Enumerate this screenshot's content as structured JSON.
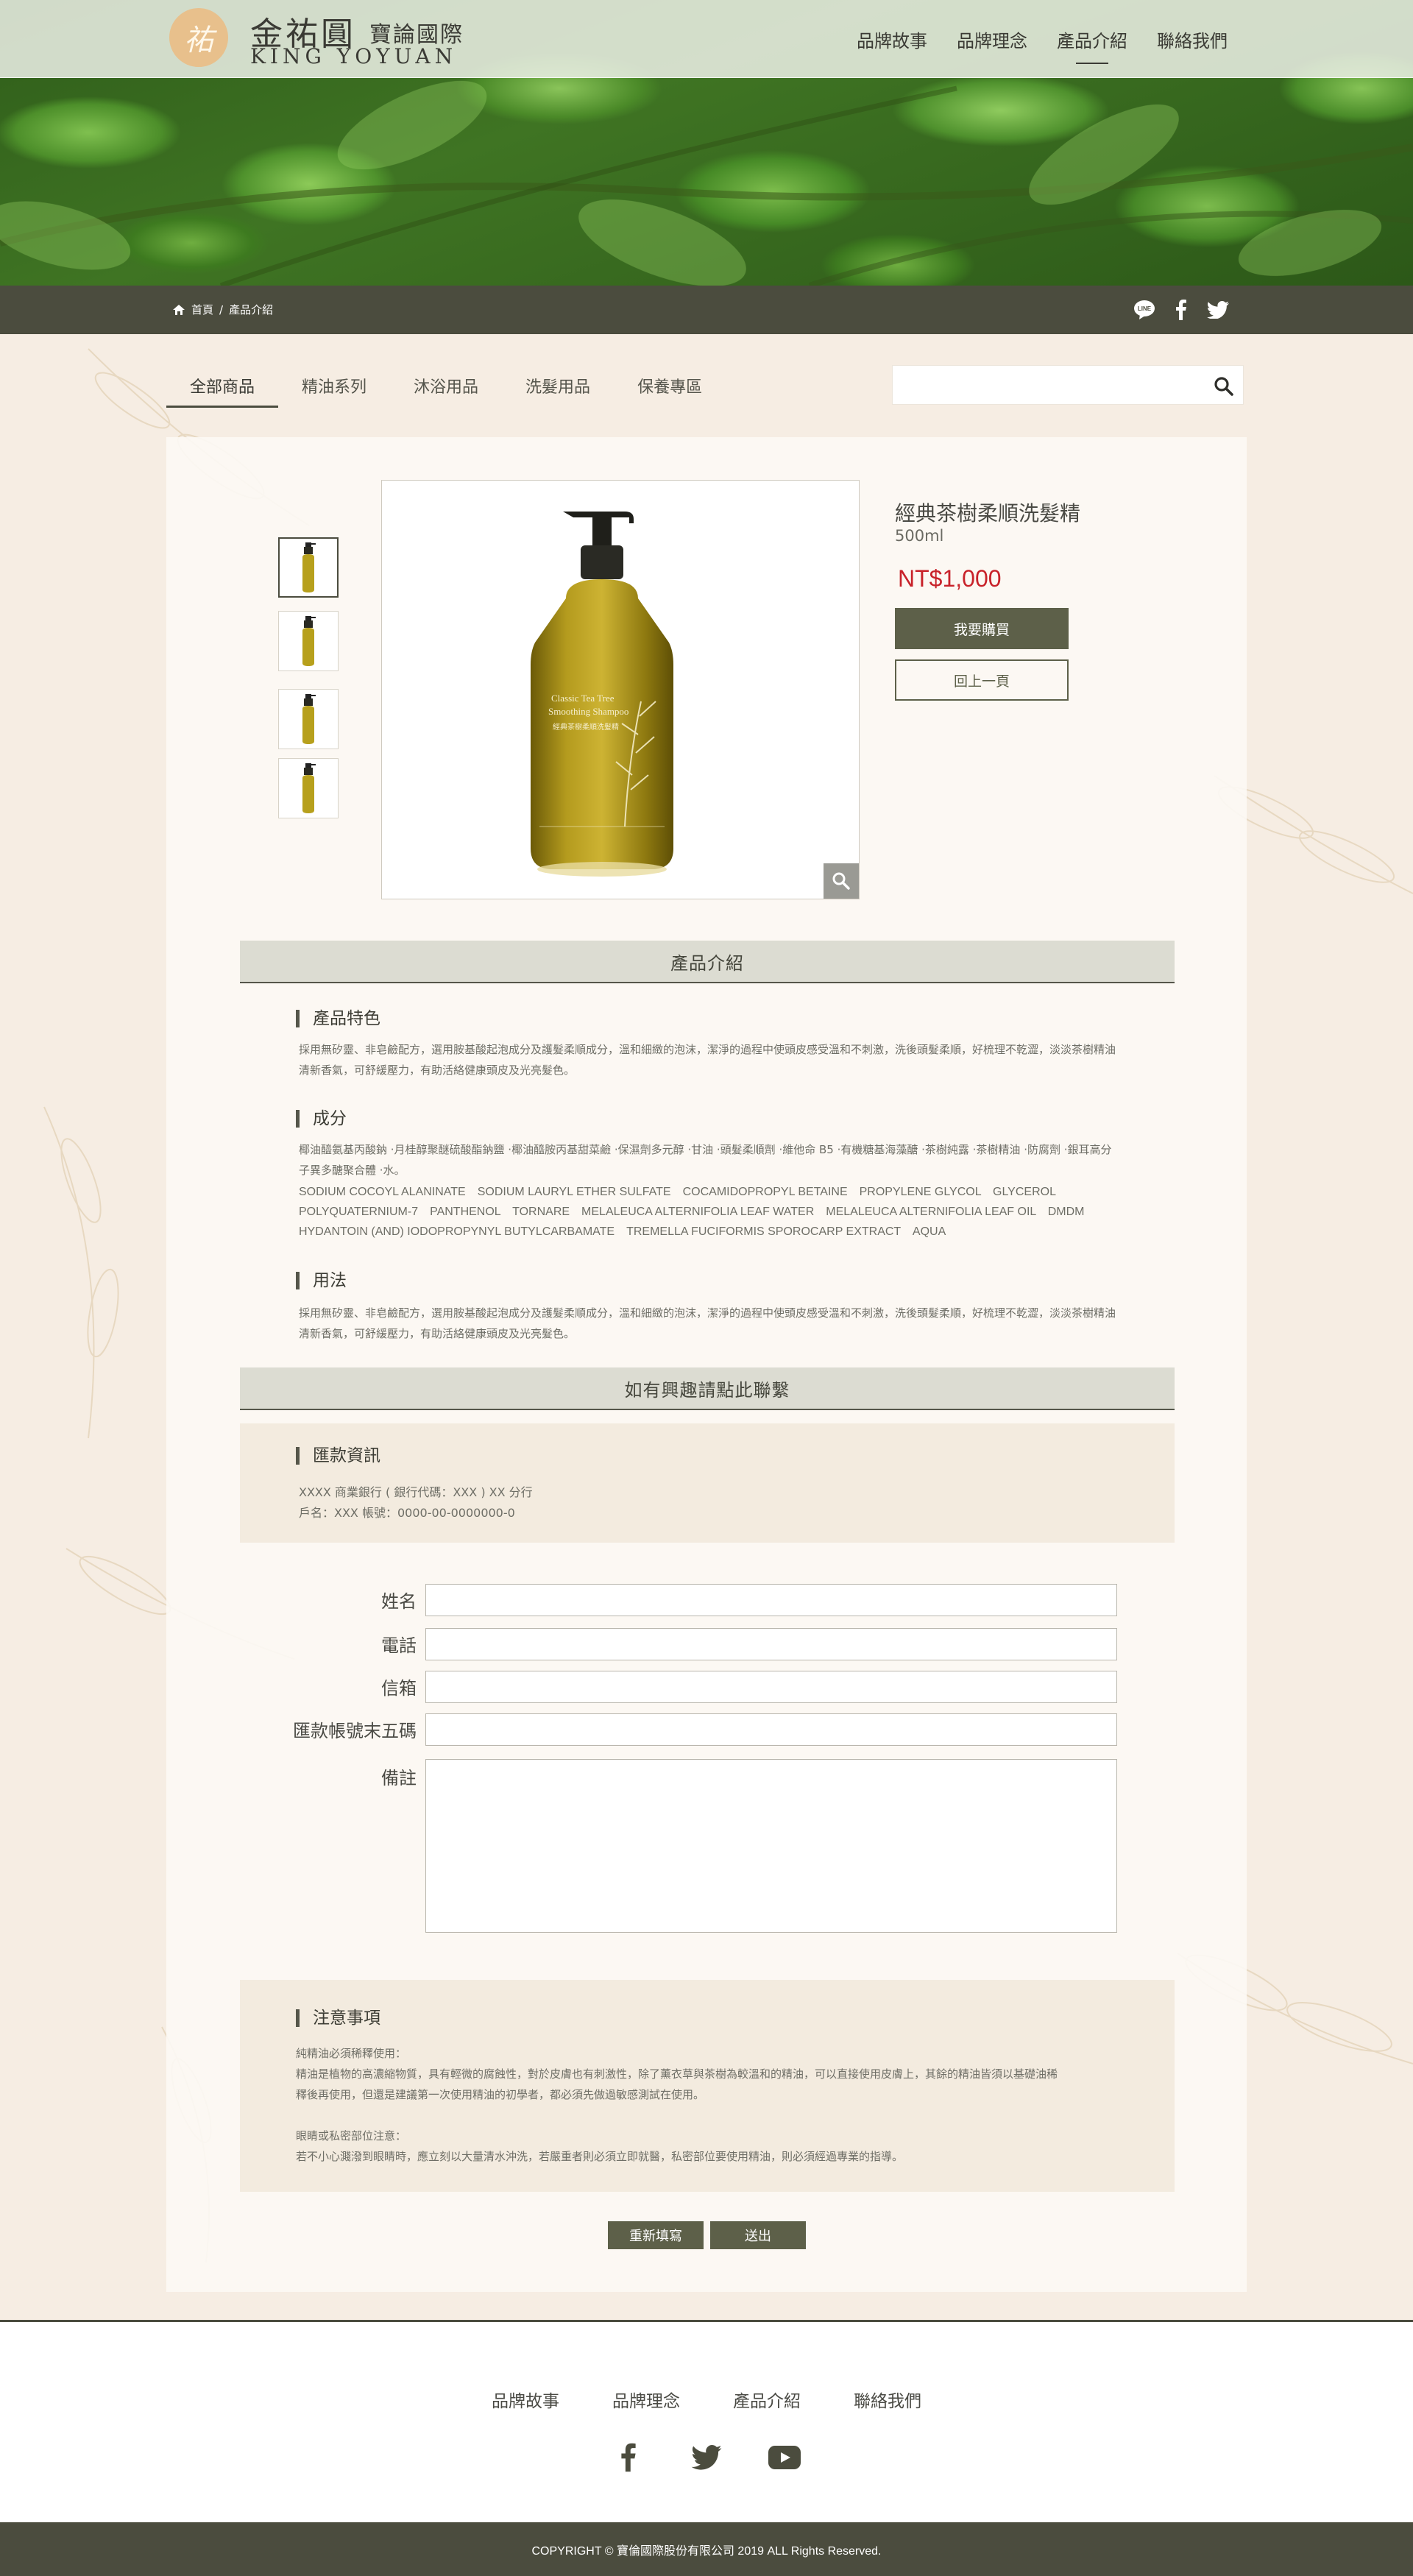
{
  "brand": {
    "logo_mark": "祐",
    "name_cn": "金祐圓",
    "name_cn_sub": "寶論國際",
    "name_en": "KING YOYUAN"
  },
  "top_nav": [
    {
      "label": "品牌故事"
    },
    {
      "label": "品牌理念"
    },
    {
      "label": "產品介紹",
      "active": true
    },
    {
      "label": "聯絡我們"
    }
  ],
  "breadcrumb": {
    "home": "首頁",
    "separator": "/",
    "current": "產品介紹"
  },
  "social_top": [
    "line-icon",
    "facebook-icon",
    "twitter-icon"
  ],
  "categories": [
    {
      "label": "全部商品",
      "active": true
    },
    {
      "label": "精油系列"
    },
    {
      "label": "沐浴用品"
    },
    {
      "label": "洗髮用品"
    },
    {
      "label": "保養專區"
    }
  ],
  "search": {
    "placeholder": "",
    "value": ""
  },
  "product": {
    "name": "經典茶樹柔順洗髮精",
    "volume": "500ml",
    "price": "NT$1,000",
    "buy_label": "我要購買",
    "back_label": "回上一頁",
    "bottle_label_en": "Classic Tea Tree Smoothing Shampoo",
    "bottle_label_cn": "經典茶樹柔順洗髮精"
  },
  "intro": {
    "title": "產品介紹",
    "features_title": "產品特色",
    "features_text": "採用無矽靈、非皂鹼配方，選用胺基酸起泡成分及護髮柔順成分，溫和細緻的泡沫，潔淨的過程中使頭皮感受溫和不刺激，洗後頭髮柔順，好梳理不乾澀，淡淡茶樹精油清新香氣，可舒緩壓力，有助活絡健康頭皮及光亮髮色。",
    "ingredients_title": "成分",
    "ingredients_cn": "椰油醯氨基丙酸鈉 ·月桂醇聚醚硫酸酯鈉鹽 ·椰油醯胺丙基甜菜鹼 ·保濕劑多元醇 ·甘油 ·頭髮柔順劑 ·維他命 B5 ·有機糖基海藻醣 ·茶樹純露 ·茶樹精油 ·防腐劑 ·銀耳高分子異多醣聚合體 ·水。",
    "ingredients_en": "SODIUM COCOYL ALANINATE　SODIUM LAURYL ETHER SULFATE　COCAMIDOPROPYL BETAINE　PROPYLENE GLYCOL　GLYCEROL　POLYQUATERNIUM-7　PANTHENOL　TORNARE　MELALEUCA ALTERNIFOLIA LEAF WATER　MELALEUCA ALTERNIFOLIA LEAF OIL　DMDM HYDANTOIN (AND) IODOPROPYNYL BUTYLCARBAMATE　TREMELLA FUCIFORMIS SPOROCARP EXTRACT　AQUA",
    "usage_title": "用法",
    "usage_text": "採用無矽靈、非皂鹼配方，選用胺基酸起泡成分及護髮柔順成分，溫和細緻的泡沫，潔淨的過程中使頭皮感受溫和不刺激，洗後頭髮柔順，好梳理不乾澀，淡淡茶樹精油清新香氣，可舒緩壓力，有助活絡健康頭皮及光亮髮色。"
  },
  "contact": {
    "title": "如有興趣請點此聯繫",
    "bank_title": "匯款資訊",
    "bank_line1": "XXXX 商業銀行 ( 銀行代碼：XXX ) XX 分行",
    "bank_line2": "戶名：XXX 帳號：0000-00-0000000-0"
  },
  "form": {
    "name_label": "姓名",
    "phone_label": "電話",
    "email_label": "信箱",
    "account_label": "匯款帳號末五碼",
    "note_label": "備註"
  },
  "notice": {
    "title": "注意事項",
    "line1": "純精油必須稀釋使用：",
    "line2": "精油是植物的高濃縮物質，具有輕微的腐蝕性，對於皮膚也有刺激性，除了薰衣草與茶樹為較溫和的精油，可以直接使用皮膚上，其餘的精油皆須以基礎油稀",
    "line3": "釋後再使用，但還是建議第一次使用精油的初學者，都必須先做過敏感測試在使用。",
    "line4": "眼睛或私密部位注意：",
    "line5": "若不小心濺潑到眼睛時，應立刻以大量清水沖洗，若嚴重者則必須立即就醫，私密部位要使用精油，則必須經過專業的指導。"
  },
  "form_buttons": {
    "reset_label": "重新填寫",
    "submit_label": "送出"
  },
  "footer": {
    "nav": [
      {
        "label": "品牌故事"
      },
      {
        "label": "品牌理念"
      },
      {
        "label": "產品介紹"
      },
      {
        "label": "聯絡我們"
      }
    ],
    "social": [
      "facebook-icon",
      "twitter-icon",
      "youtube-icon"
    ],
    "copyright": "COPYRIGHT © 寶倫國際股份有限公司 2019 ALL Rights Reserved."
  },
  "colors": {
    "dark_olive": "#4b4c3e",
    "button_olive": "#5d6049",
    "price_red": "#c8222a",
    "cream_bg": "#f6ede3",
    "logo_gold": "#e8c08c"
  }
}
